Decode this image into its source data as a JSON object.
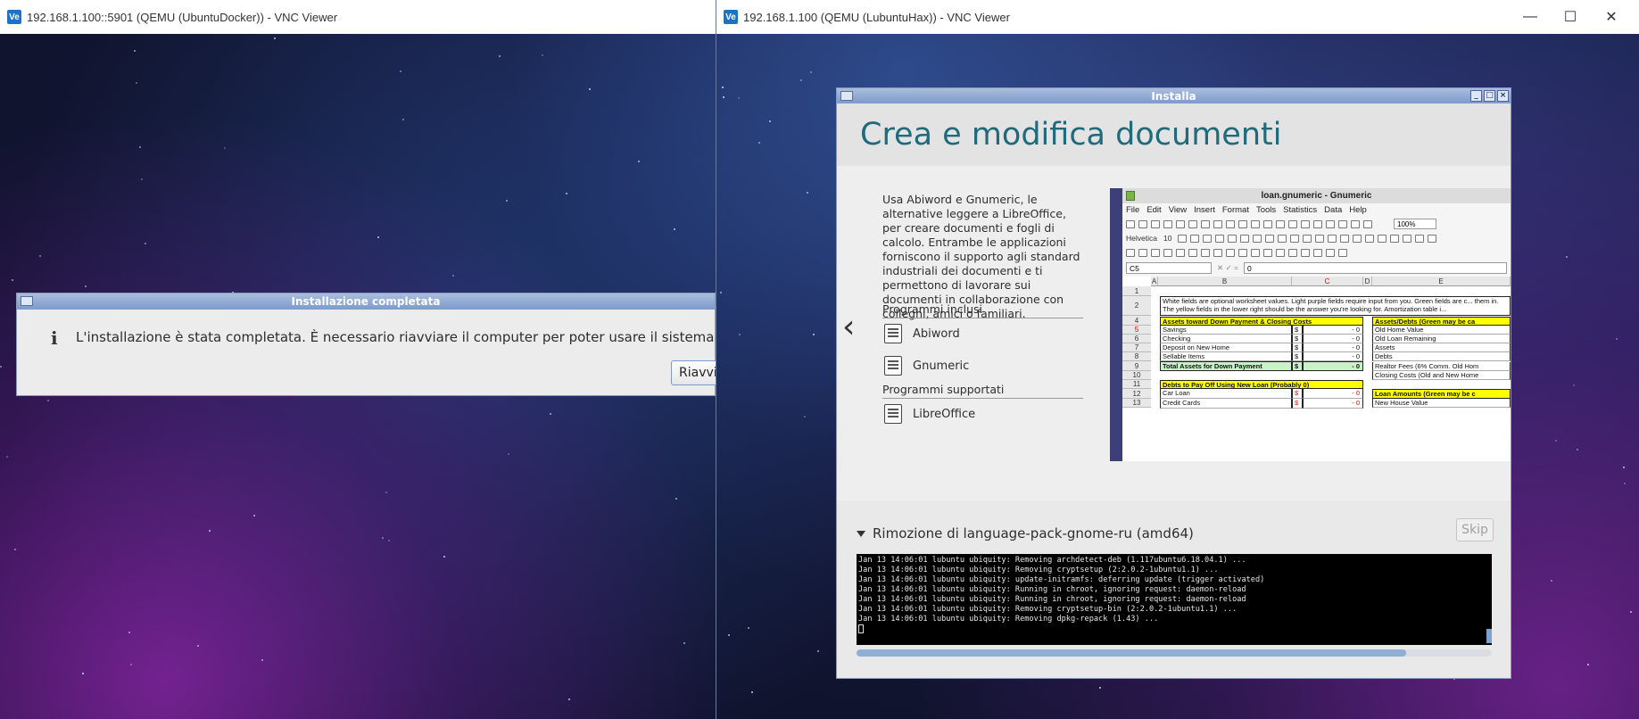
{
  "left_window": {
    "title": "192.168.1.100::5901 (QEMU (UbuntuDocker)) - VNC Viewer",
    "logo": "Ve",
    "dialog": {
      "title": "Installazione completata",
      "icon": "i",
      "message": "L'installazione è stata completata. È necessario riavviare il computer per poter usare il sistema appena insta",
      "button_label": "Riavvia"
    }
  },
  "right_window": {
    "title": "192.168.1.100 (QEMU (LubuntuHax)) - VNC Viewer",
    "logo": "Ve",
    "controls": {
      "minimize": "—",
      "maximize": "☐",
      "close": "✕"
    },
    "installer": {
      "title": "Installa",
      "slide": {
        "heading": "Crea e modifica documenti",
        "description": "Usa Abiword e Gnumeric, le alternative leggere a LibreOffice, per creare documenti e fogli di calcolo. Entrambe le applicazioni forniscono il supporto agli standard industriali dei documenti e ti permettono di lavorare sui documenti in collaborazione con colleghi, amici o familiari.",
        "included_heading": "Programmi inclusi",
        "included_apps": [
          "Abiword",
          "Gnumeric"
        ],
        "supported_heading": "Programmi supportati",
        "supported_apps": [
          "LibreOffice"
        ],
        "prev_arrow": "‹",
        "next_arrow": "›",
        "screenshot": {
          "title": "loan.gnumeric - Gnumeric",
          "menu": [
            "File",
            "Edit",
            "View",
            "Insert",
            "Format",
            "Tools",
            "Statistics",
            "Data",
            "Help"
          ],
          "font_name": "Helvetica",
          "font_size": "10",
          "zoom": "100%",
          "cell_ref": "C5",
          "formula_value": "0",
          "columns": [
            "A",
            "B",
            "C",
            "D",
            "E"
          ],
          "rows": [
            "1",
            "2",
            "4",
            "5",
            "6",
            "7",
            "8",
            "9",
            "10",
            "11",
            "12",
            "13"
          ],
          "note": "White fields are optional worksheet values. Light purple fields require input from you. Green fields are c... them in. The yellow fields in the lower right should be the answer you're looking for. Amortization table i...",
          "assets_header": "Assets toward Down Payment & Closing Costs",
          "assets_items": [
            "Savings",
            "Checking",
            "Deposit on New Home",
            "Sellable Items"
          ],
          "dollar": "$",
          "zero": "- 0",
          "total_assets": "Total Assets for Down Payment",
          "debts_header": "Debts to Pay Off Using New Loan (Probably 0)",
          "debts_items": [
            "Car Loan",
            "Credit Cards"
          ],
          "right_header": "Assets/Debts (Green may be ca",
          "right_items": [
            "Old Home Value",
            "Old Loan Remaining",
            "Assets",
            "Debts",
            "Realtor Fees (6% Comm. Old Hom",
            "Closing Costs (Old and New Home"
          ],
          "loan_header": "Loan Amounts (Green may be c",
          "loan_items": [
            "New House Value"
          ]
        }
      },
      "progress": {
        "step": "Rimozione di language-pack-gnome-ru (amd64)",
        "skip_label": "Skip",
        "log": [
          "Jan 13 14:06:01 lubuntu ubiquity: Removing archdetect-deb (1.117ubuntu6.18.04.1) ...",
          "Jan 13 14:06:01 lubuntu ubiquity: Removing cryptsetup (2:2.0.2-1ubuntu1.1) ...",
          "Jan 13 14:06:01 lubuntu ubiquity: update-initramfs: deferring update (trigger activated)",
          "Jan 13 14:06:01 lubuntu ubiquity: Running in chroot, ignoring request: daemon-reload",
          "Jan 13 14:06:01 lubuntu ubiquity: Running in chroot, ignoring request: daemon-reload",
          "Jan 13 14:06:01 lubuntu ubiquity: Removing cryptsetup-bin (2:2.0.2-1ubuntu1.1) ...",
          "Jan 13 14:06:01 lubuntu ubiquity: Removing dpkg-repack (1.43) ..."
        ],
        "scroll_fraction": 0.865
      }
    }
  }
}
